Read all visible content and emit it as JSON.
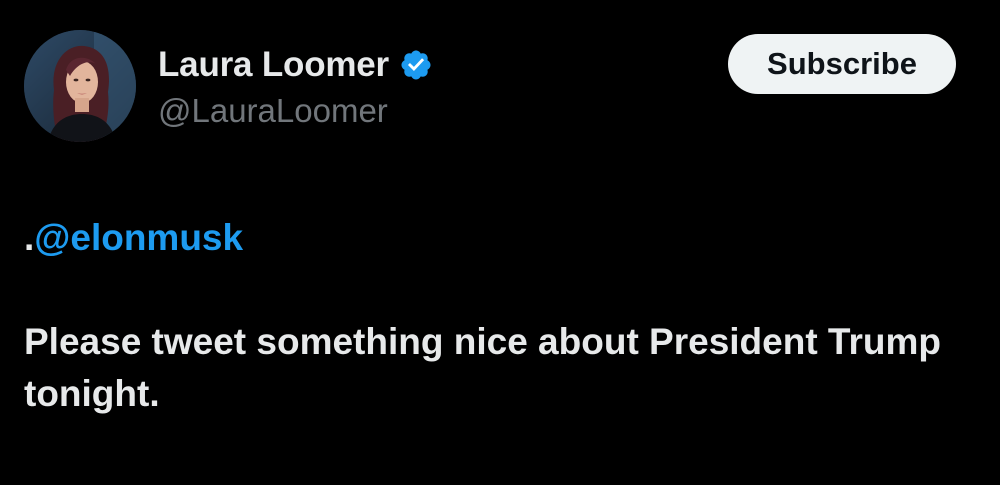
{
  "author": {
    "display_name": "Laura Loomer",
    "handle": "@LauraLoomer",
    "verified_icon": "verified-badge-icon",
    "avatar_icon": "profile-avatar"
  },
  "actions": {
    "subscribe_label": "Subscribe"
  },
  "tweet": {
    "mention_prefix": ".",
    "mention": "@elonmusk",
    "text": "Please tweet something nice about President Trump tonight."
  },
  "colors": {
    "background": "#000000",
    "text": "#e7e9ea",
    "secondary_text": "#71767b",
    "link": "#1d9bf0",
    "verified": "#1d9bf0",
    "button_bg": "#eff3f4",
    "button_text": "#0f1419"
  }
}
